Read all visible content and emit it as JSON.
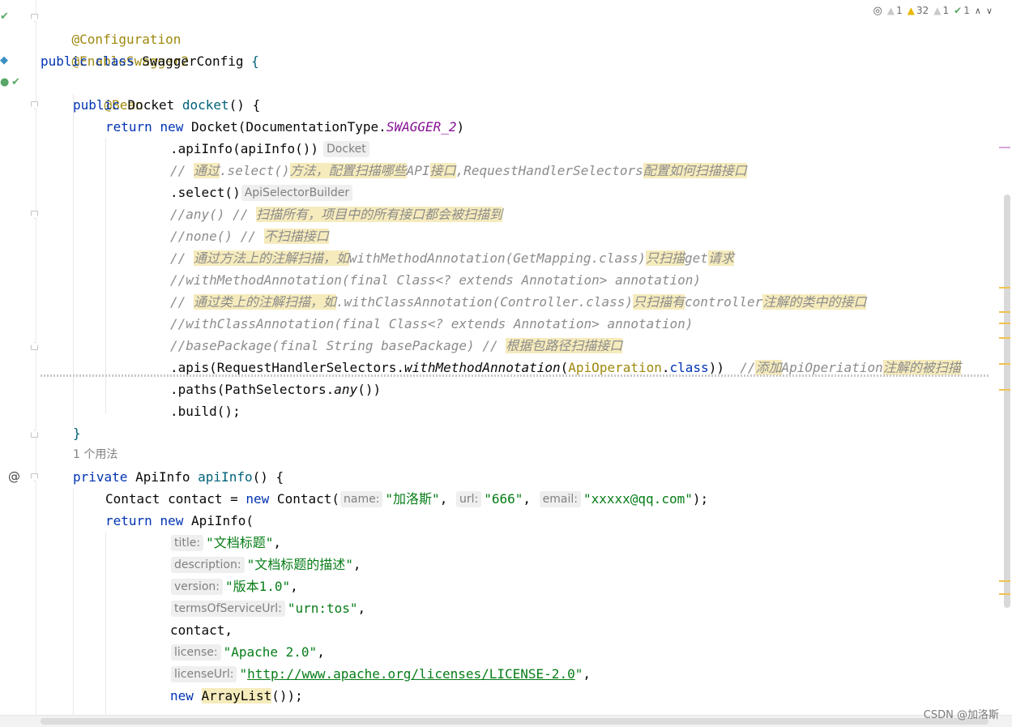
{
  "inspection_widget": {
    "counts": [
      {
        "icon": "warning-gray-icon",
        "count": "1"
      },
      {
        "icon": "warning-yellow-icon",
        "count": "32"
      },
      {
        "icon": "weak-warning-icon",
        "count": "1"
      },
      {
        "icon": "typo-check-icon",
        "count": "1"
      }
    ]
  },
  "editor": {
    "code": {
      "l1_ann": "@Configuration",
      "l2_ann": "@EnableSwagger2",
      "l3_kw1": "public",
      "l3_kw2": "class",
      "l3_name": "SwaggerConfig",
      "l3_brace": "{",
      "l4_ann": "@Bean",
      "l5_kw": "public",
      "l5_type": "Docket",
      "l5_fn": "docket",
      "l5_rest": "() {",
      "l6_kw1": "return",
      "l6_kw2": "new",
      "l6_call": "Docket(DocumentationType.",
      "l6_const": "SWAGGER_2",
      "l6_end": ")",
      "l7_text": ".apiInfo(apiInfo())",
      "l7_hint": "Docket",
      "l8_c1": "// ",
      "l8_c2": "通过",
      "l8_c3": ".select()",
      "l8_c4": "方法，配置扫描哪些",
      "l8_c5": "API",
      "l8_c6": "接口",
      "l8_c7": ",RequestHandlerSelectors",
      "l8_c8": "配置如何扫描接口",
      "l9_text": ".select()",
      "l9_hint": "ApiSelectorBuilder",
      "l10_c1": "//any() // ",
      "l10_c2": "扫描所有，项目中的所有接口都会被扫描到",
      "l11_c1": "//none() // ",
      "l11_c2": "不扫描接口",
      "l12_c1": "// ",
      "l12_c2": "通过方法上的注解扫描，如",
      "l12_c3": "withMethodAnnotation(GetMapping.class)",
      "l12_c4": "只扫描",
      "l12_c5": "get",
      "l12_c6": "请求",
      "l13_c1": "//withMethodAnnotation(final Class<? extends Annotation> annotation)",
      "l14_c1": "// ",
      "l14_c2": "通过类上的注解扫描，如",
      "l14_c3": ".withClassAnnotation(Controller.class)",
      "l14_c4": "只扫描有",
      "l14_c5": "controller",
      "l14_c6": "注解的类中的接口",
      "l15_c1": "//withClassAnnotation(final Class<? extends Annotation> annotation)",
      "l16_c1": "//basePackage(final String basePackage) // ",
      "l16_c2": "根据包路径扫描接口",
      "l17_a": ".apis(RequestHandlerSelectors.",
      "l17_b": "withMethodAnnotation",
      "l17_c": "(",
      "l17_d": "ApiOperation",
      "l17_e": ".",
      "l17_f": "class",
      "l17_g": "))  ",
      "l17_h": "//",
      "l17_i": "添加",
      "l17_j": "ApiOperiation",
      "l17_k": "注解的被扫描",
      "l18_a": ".paths(PathSelectors.",
      "l18_b": "any",
      "l18_c": "())",
      "l19_text": ".build();",
      "l20_text": "}",
      "usage": "1 个用法",
      "l21_kw": "private",
      "l21_type": "ApiInfo",
      "l21_fn": "apiInfo",
      "l21_rest": "() {",
      "l22_a": "Contact contact = ",
      "l22_kw": "new",
      "l22_b": " Contact(",
      "l22_h1": "name:",
      "l22_s1": "\"加洛斯\"",
      "l22_sep1": ", ",
      "l22_h2": "url:",
      "l22_s2": "\"666\"",
      "l22_sep2": ", ",
      "l22_h3": "email:",
      "l22_s3": "\"xxxxx@qq.com\"",
      "l22_end": ");",
      "l23_kw1": "return",
      "l23_kw2": "new",
      "l23_b": "ApiInfo(",
      "l24_h": "title:",
      "l24_s": "\"文档标题\"",
      "l24_end": ",",
      "l25_h": "description:",
      "l25_s": "\"文档标题的描述\"",
      "l25_end": ",",
      "l26_h": "version:",
      "l26_s": "\"版本1.0\"",
      "l26_end": ",",
      "l27_h": "termsOfServiceUrl:",
      "l27_s": "\"urn:tos\"",
      "l27_end": ",",
      "l28_text": "contact,",
      "l29_h": "license:",
      "l29_s": "\"Apache 2.0\"",
      "l29_end": ",",
      "l30_h": "licenseUrl:",
      "l30_s1": "\"",
      "l30_s2": "http://www.apache.org/licenses/LICENSE-2.0",
      "l30_s3": "\"",
      "l30_end": ",",
      "l31_kw": "new",
      "l31_b": "ArrayList",
      "l31_c": "());"
    }
  },
  "gutter": {
    "at_marker": "@"
  },
  "watermark": "CSDN @加洛斯",
  "colors": {
    "keyword": "#0033b3",
    "annotation": "#9e880d",
    "comment": "#8c8c8c",
    "string": "#067d17",
    "highlight": "#f6ebbc",
    "constant": "#871094"
  }
}
